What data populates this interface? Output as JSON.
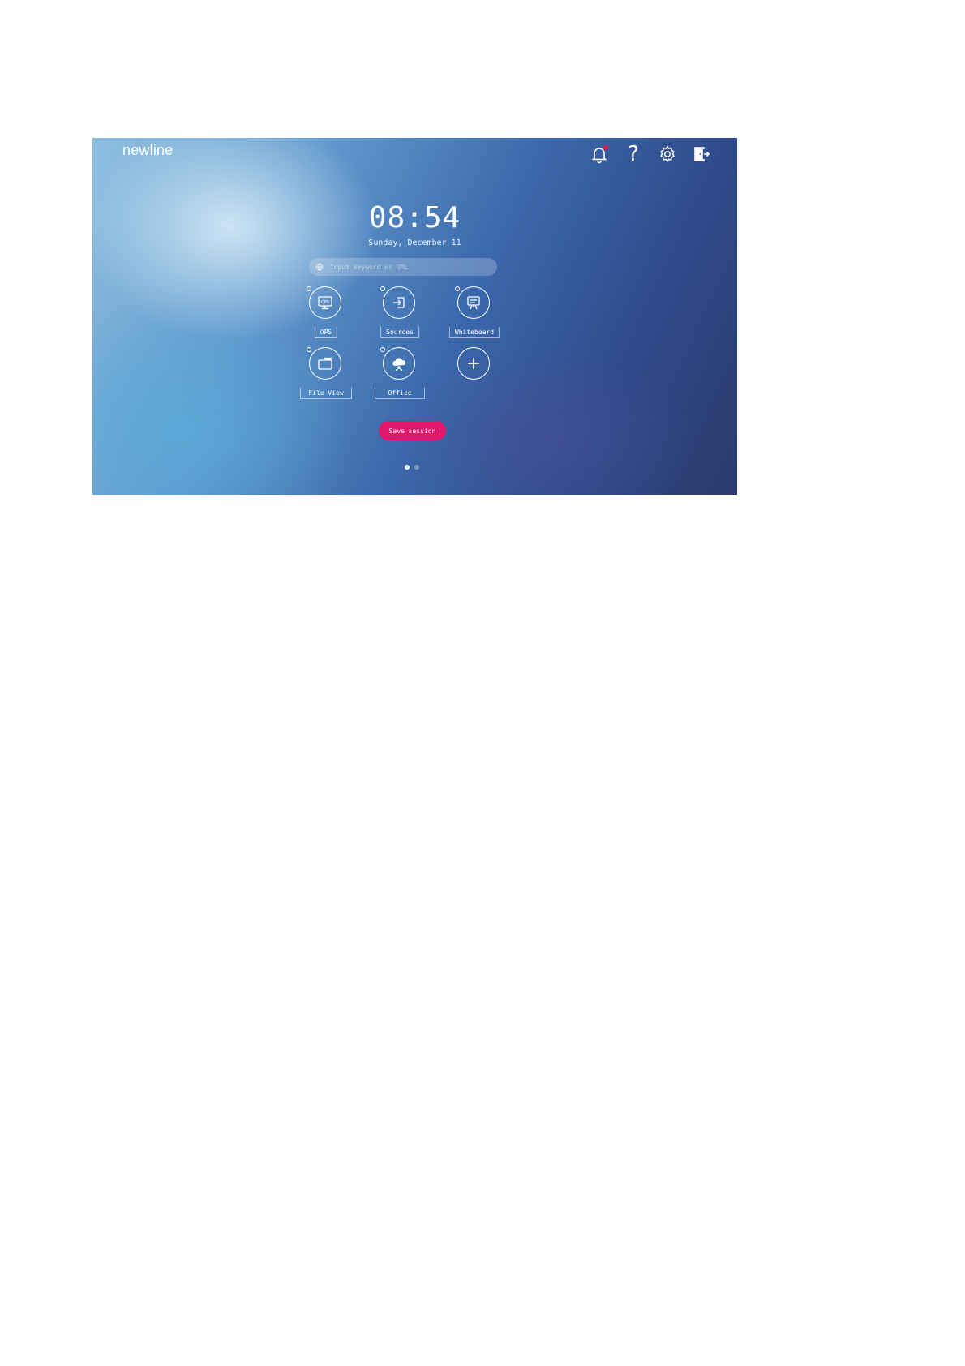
{
  "header": {
    "logo": "newline",
    "icons": [
      "notification-bell-icon",
      "help-icon",
      "settings-gear-icon",
      "exit-door-icon"
    ],
    "help_glyph": "?"
  },
  "clock": {
    "time": "08:54",
    "date": "Sunday, December 11"
  },
  "search": {
    "placeholder": "Input keyword or URL",
    "value": ""
  },
  "apps": [
    {
      "label": "OPS",
      "icon": "ops-monitor-icon"
    },
    {
      "label": "Sources",
      "icon": "sources-input-icon"
    },
    {
      "label": "Whiteboard",
      "icon": "whiteboard-easel-icon"
    },
    {
      "label": "File View",
      "icon": "folder-icon"
    },
    {
      "label": "Office",
      "icon": "office-cloud-icon"
    },
    {
      "label": "",
      "icon": "add-plus-icon"
    }
  ],
  "ops_badge": "OPS",
  "actions": {
    "save_session": "Save session"
  },
  "pagination": {
    "current": 1,
    "total": 2
  },
  "colors": {
    "accent": "#e0176b",
    "notification": "#e0194f"
  }
}
